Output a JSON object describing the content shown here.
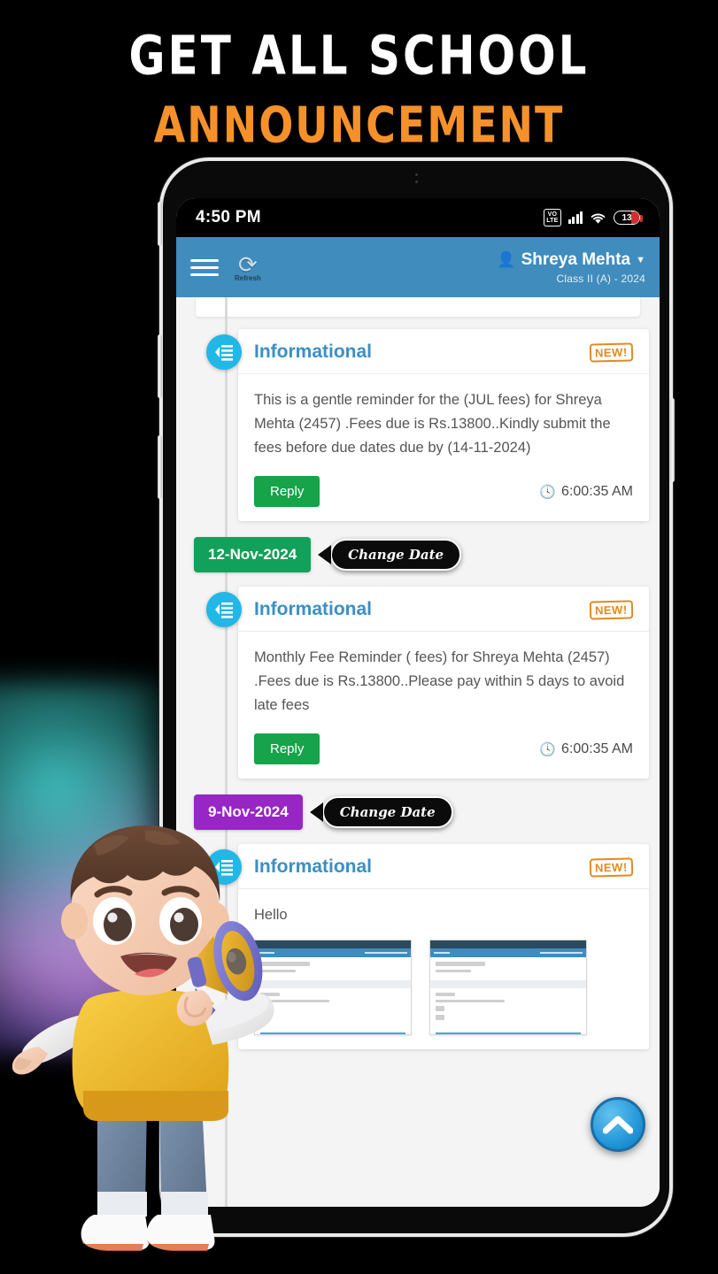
{
  "promo": {
    "headline_line1": "GET ALL SCHOOL",
    "headline_line2": "ANNOUNCEMENT",
    "headline_color_1": "#ffffff",
    "headline_color_2": "#f5912b"
  },
  "status_bar": {
    "time": "4:50 PM",
    "volte_label": "VoLTE",
    "signal_icon": "signal-bars-icon",
    "wifi_icon": "wifi-icon",
    "battery_level": "13",
    "battery_icon": "battery-low-icon"
  },
  "app_bar": {
    "menu_icon": "hamburger-menu-icon",
    "refresh_icon": "refresh-icon",
    "refresh_label": "Refresh",
    "avatar_icon": "user-avatar-icon",
    "user_name": "Shreya Mehta",
    "caret_icon": "chevron-down-icon",
    "class_label": "Class II (A) - 2024",
    "bar_color": "#3f8cbd"
  },
  "feed": {
    "timeline_icon": "announcement-list-icon",
    "new_badge": "NEW!",
    "clock_icon": "clock-icon",
    "reply_label": "Reply",
    "change_date_label": "Change Date",
    "items": [
      {
        "title": "Informational",
        "message": "This is a gentle reminder for the (JUL fees) for Shreya Mehta (2457) .Fees due is Rs.13800..Kindly submit the fees before due dates due by (14-11-2024)",
        "time": "6:00:35 AM"
      },
      {
        "title": "Informational",
        "message": "Monthly Fee Reminder ( fees) for Shreya Mehta (2457) .Fees due is Rs.13800..Please pay within 5 days to avoid late fees",
        "time": "6:00:35 AM"
      },
      {
        "title": "Informational",
        "message": "Hello",
        "time": ""
      }
    ],
    "date_separators": [
      {
        "label": "12-Nov-2024",
        "color": "#13a05a"
      },
      {
        "label": "9-Nov-2024",
        "color": "#9726c4"
      }
    ],
    "scroll_top_icon": "chevron-up-icon"
  },
  "nav_bar": {
    "recents_icon": "square-recents-icon",
    "home_icon": "circle-home-icon",
    "back_icon": "triangle-back-icon"
  },
  "decor": {
    "mascot_icon": "boy-with-megaphone-illustration"
  }
}
